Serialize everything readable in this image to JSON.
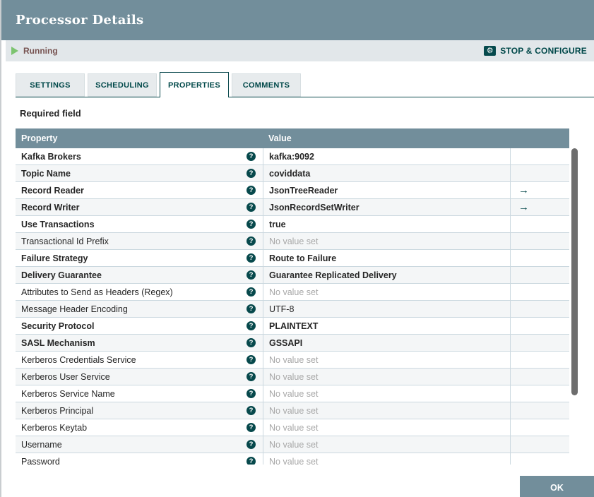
{
  "header": {
    "title": "Processor Details"
  },
  "status_bar": {
    "state_label": "Running",
    "stop_configure_label": "STOP & CONFIGURE"
  },
  "tabs": [
    {
      "label": "SETTINGS",
      "active": false
    },
    {
      "label": "SCHEDULING",
      "active": false
    },
    {
      "label": "PROPERTIES",
      "active": true
    },
    {
      "label": "COMMENTS",
      "active": false
    }
  ],
  "required_note": "Required field",
  "properties_table": {
    "columns": {
      "property": "Property",
      "value": "Value"
    },
    "rows": [
      {
        "property": "Kafka Brokers",
        "value": "kafka:9092",
        "required": true,
        "unset": false,
        "link": false
      },
      {
        "property": "Topic Name",
        "value": "coviddata",
        "required": true,
        "unset": false,
        "link": false
      },
      {
        "property": "Record Reader",
        "value": "JsonTreeReader",
        "required": true,
        "unset": false,
        "link": true
      },
      {
        "property": "Record Writer",
        "value": "JsonRecordSetWriter",
        "required": true,
        "unset": false,
        "link": true
      },
      {
        "property": "Use Transactions",
        "value": "true",
        "required": true,
        "unset": false,
        "link": false
      },
      {
        "property": "Transactional Id Prefix",
        "value": "No value set",
        "required": false,
        "unset": true,
        "link": false
      },
      {
        "property": "Failure Strategy",
        "value": "Route to Failure",
        "required": true,
        "unset": false,
        "link": false
      },
      {
        "property": "Delivery Guarantee",
        "value": "Guarantee Replicated Delivery",
        "required": true,
        "unset": false,
        "link": false
      },
      {
        "property": "Attributes to Send as Headers (Regex)",
        "value": "No value set",
        "required": false,
        "unset": true,
        "link": false
      },
      {
        "property": "Message Header Encoding",
        "value": "UTF-8",
        "required": false,
        "unset": false,
        "link": false
      },
      {
        "property": "Security Protocol",
        "value": "PLAINTEXT",
        "required": true,
        "unset": false,
        "link": false
      },
      {
        "property": "SASL Mechanism",
        "value": "GSSAPI",
        "required": true,
        "unset": false,
        "link": false
      },
      {
        "property": "Kerberos Credentials Service",
        "value": "No value set",
        "required": false,
        "unset": true,
        "link": false
      },
      {
        "property": "Kerberos User Service",
        "value": "No value set",
        "required": false,
        "unset": true,
        "link": false
      },
      {
        "property": "Kerberos Service Name",
        "value": "No value set",
        "required": false,
        "unset": true,
        "link": false
      },
      {
        "property": "Kerberos Principal",
        "value": "No value set",
        "required": false,
        "unset": true,
        "link": false
      },
      {
        "property": "Kerberos Keytab",
        "value": "No value set",
        "required": false,
        "unset": true,
        "link": false
      },
      {
        "property": "Username",
        "value": "No value set",
        "required": false,
        "unset": true,
        "link": false
      },
      {
        "property": "Password",
        "value": "No value set",
        "required": false,
        "unset": true,
        "link": false
      }
    ]
  },
  "footer": {
    "ok_label": "OK"
  },
  "icons": {
    "help": "?",
    "goto_arrow": "→",
    "gear": "⚙"
  },
  "colors": {
    "header_bg": "#728E9B",
    "accent_teal": "#004849",
    "running_green": "#7DC470",
    "running_text": "#775351",
    "status_bar_bg": "#E2E7EA",
    "row_alt_bg": "#F4F6F7",
    "row_border": "#CBD8DF",
    "unset_text": "#A8A8A8",
    "scrollbar_thumb": "#6D6D6D"
  }
}
